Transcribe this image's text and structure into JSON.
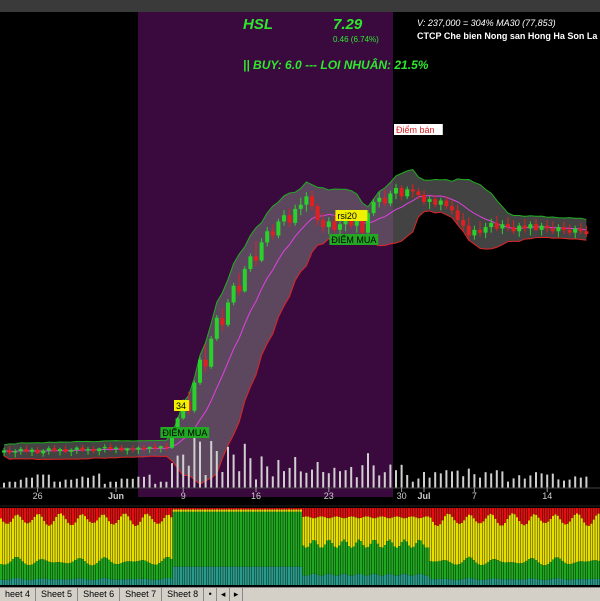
{
  "header": {
    "symbol": "HSL",
    "price": "7.29",
    "change": "0.46 (6.74%)",
    "volume_info": "V: 237,000  =  304%  MA30 (77,853)",
    "company": "CTCP Che bien Nong san Hong Ha Son La",
    "signal": "|| BUY: 6.0  ---  LOI NHUÂN: 21.5%"
  },
  "colors": {
    "background": "#000000",
    "highlight_band": "#3a0a3e",
    "up": "#2bd12b",
    "down": "#e02020",
    "ma": "#e040e0",
    "bb_upper": "#1fae1f",
    "bb_lower": "#e02525",
    "label_green_bg": "#22a822",
    "label_yellow_bg": "#f0f000",
    "label_sell": "#e02020",
    "volume": "#cfcfcf",
    "sentiment_red": "#e01010",
    "sentiment_yellow": "#e8e000",
    "sentiment_green": "#1fa81f",
    "sentiment_teal": "#2a9a8a"
  },
  "chart_data": {
    "type": "candlestick",
    "x_tick_labels": [
      "26",
      "Jun",
      "9",
      "16",
      "23",
      "30",
      "Jul",
      "7",
      "14"
    ],
    "annotations": {
      "buy_label_1": "ĐIỂM MUA",
      "buy_label_2": "ĐIỂM MUA",
      "sell_label": "Điểm bán",
      "tag_34": "34",
      "tag_rsi": "rsi20"
    },
    "price_range": [
      3.3,
      8.6
    ],
    "ohlc": [
      [
        3.55,
        3.62,
        3.5,
        3.58
      ],
      [
        3.58,
        3.64,
        3.52,
        3.55
      ],
      [
        3.55,
        3.6,
        3.48,
        3.57
      ],
      [
        3.57,
        3.63,
        3.52,
        3.6
      ],
      [
        3.6,
        3.65,
        3.55,
        3.56
      ],
      [
        3.56,
        3.62,
        3.5,
        3.59
      ],
      [
        3.59,
        3.63,
        3.53,
        3.54
      ],
      [
        3.54,
        3.6,
        3.49,
        3.58
      ],
      [
        3.58,
        3.64,
        3.52,
        3.61
      ],
      [
        3.61,
        3.66,
        3.55,
        3.57
      ],
      [
        3.57,
        3.62,
        3.51,
        3.6
      ],
      [
        3.6,
        3.65,
        3.54,
        3.56
      ],
      [
        3.56,
        3.61,
        3.5,
        3.59
      ],
      [
        3.59,
        3.64,
        3.53,
        3.62
      ],
      [
        3.62,
        3.66,
        3.56,
        3.58
      ],
      [
        3.58,
        3.63,
        3.52,
        3.6
      ],
      [
        3.6,
        3.64,
        3.54,
        3.57
      ],
      [
        3.57,
        3.62,
        3.51,
        3.61
      ],
      [
        3.61,
        3.67,
        3.55,
        3.63
      ],
      [
        3.63,
        3.68,
        3.57,
        3.6
      ],
      [
        3.6,
        3.64,
        3.54,
        3.62
      ],
      [
        3.62,
        3.66,
        3.56,
        3.58
      ],
      [
        3.58,
        3.62,
        3.52,
        3.61
      ],
      [
        3.61,
        3.65,
        3.55,
        3.59
      ],
      [
        3.59,
        3.64,
        3.53,
        3.62
      ],
      [
        3.62,
        3.66,
        3.56,
        3.6
      ],
      [
        3.6,
        3.64,
        3.54,
        3.63
      ],
      [
        3.63,
        3.68,
        3.57,
        3.61
      ],
      [
        3.61,
        3.65,
        3.55,
        3.64
      ],
      [
        3.64,
        3.69,
        3.58,
        3.62
      ],
      [
        3.62,
        3.82,
        3.6,
        3.8
      ],
      [
        3.8,
        4.06,
        3.78,
        4.04
      ],
      [
        4.04,
        4.31,
        4.02,
        4.28
      ],
      [
        4.28,
        4.42,
        4.1,
        4.15
      ],
      [
        4.15,
        4.58,
        4.12,
        4.55
      ],
      [
        4.55,
        4.92,
        4.52,
        4.88
      ],
      [
        4.88,
        5.1,
        4.7,
        4.78
      ],
      [
        4.78,
        5.22,
        4.75,
        5.18
      ],
      [
        5.18,
        5.52,
        5.15,
        5.48
      ],
      [
        5.48,
        5.62,
        5.3,
        5.38
      ],
      [
        5.38,
        5.75,
        5.35,
        5.7
      ],
      [
        5.7,
        5.98,
        5.66,
        5.94
      ],
      [
        5.94,
        6.12,
        5.8,
        5.86
      ],
      [
        5.86,
        6.22,
        5.84,
        6.18
      ],
      [
        6.18,
        6.4,
        6.14,
        6.36
      ],
      [
        6.36,
        6.58,
        6.22,
        6.3
      ],
      [
        6.3,
        6.62,
        6.28,
        6.56
      ],
      [
        6.56,
        6.78,
        6.5,
        6.72
      ],
      [
        6.72,
        6.82,
        6.6,
        6.66
      ],
      [
        6.66,
        6.9,
        6.62,
        6.86
      ],
      [
        6.86,
        7.02,
        6.8,
        6.95
      ],
      [
        6.95,
        7.05,
        6.78,
        6.84
      ],
      [
        6.84,
        7.1,
        6.8,
        7.04
      ],
      [
        7.04,
        7.2,
        6.95,
        7.1
      ],
      [
        7.1,
        7.28,
        7.0,
        7.22
      ],
      [
        7.22,
        7.3,
        7.02,
        7.08
      ],
      [
        7.08,
        7.12,
        6.8,
        6.88
      ],
      [
        6.88,
        6.98,
        6.7,
        6.78
      ],
      [
        6.78,
        6.92,
        6.68,
        6.86
      ],
      [
        6.86,
        6.95,
        6.7,
        6.74
      ],
      [
        6.74,
        6.9,
        6.62,
        6.82
      ],
      [
        6.82,
        6.96,
        6.72,
        6.9
      ],
      [
        6.9,
        7.0,
        6.76,
        6.8
      ],
      [
        6.8,
        6.94,
        6.7,
        6.88
      ],
      [
        6.88,
        6.98,
        6.62,
        6.7
      ],
      [
        6.7,
        7.02,
        6.68,
        6.98
      ],
      [
        6.98,
        7.18,
        6.94,
        7.14
      ],
      [
        7.14,
        7.28,
        7.06,
        7.2
      ],
      [
        7.2,
        7.32,
        7.08,
        7.12
      ],
      [
        7.12,
        7.3,
        7.08,
        7.26
      ],
      [
        7.26,
        7.4,
        7.18,
        7.34
      ],
      [
        7.34,
        7.38,
        7.16,
        7.22
      ],
      [
        7.22,
        7.36,
        7.18,
        7.32
      ],
      [
        7.32,
        7.4,
        7.2,
        7.29
      ],
      [
        7.29,
        7.34,
        7.18,
        7.24
      ],
      [
        7.24,
        7.3,
        7.1,
        7.14
      ],
      [
        7.14,
        7.22,
        7.04,
        7.18
      ],
      [
        7.18,
        7.24,
        7.06,
        7.1
      ],
      [
        7.1,
        7.2,
        7.02,
        7.16
      ],
      [
        7.16,
        7.22,
        7.04,
        7.08
      ],
      [
        7.08,
        7.16,
        6.96,
        7.02
      ],
      [
        7.02,
        7.1,
        6.82,
        6.88
      ],
      [
        6.88,
        6.98,
        6.72,
        6.8
      ],
      [
        6.8,
        6.92,
        6.58,
        6.66
      ],
      [
        6.66,
        6.8,
        6.6,
        6.74
      ],
      [
        6.74,
        6.86,
        6.64,
        6.7
      ],
      [
        6.7,
        6.84,
        6.62,
        6.78
      ],
      [
        6.78,
        6.9,
        6.7,
        6.84
      ],
      [
        6.84,
        6.94,
        6.72,
        6.76
      ],
      [
        6.76,
        6.88,
        6.68,
        6.82
      ],
      [
        6.82,
        6.92,
        6.72,
        6.78
      ],
      [
        6.78,
        6.88,
        6.68,
        6.72
      ],
      [
        6.72,
        6.84,
        6.64,
        6.8
      ],
      [
        6.8,
        6.9,
        6.7,
        6.76
      ],
      [
        6.76,
        6.86,
        6.66,
        6.82
      ],
      [
        6.82,
        6.9,
        6.72,
        6.74
      ],
      [
        6.74,
        6.84,
        6.66,
        6.8
      ],
      [
        6.8,
        6.88,
        6.7,
        6.76
      ],
      [
        6.76,
        6.86,
        6.68,
        6.72
      ],
      [
        6.72,
        6.82,
        6.64,
        6.78
      ],
      [
        6.78,
        6.86,
        6.68,
        6.74
      ],
      [
        6.74,
        6.82,
        6.66,
        6.7
      ],
      [
        6.7,
        6.8,
        6.62,
        6.76
      ],
      [
        6.76,
        6.84,
        6.68,
        6.72
      ],
      [
        6.72,
        6.8,
        6.64,
        6.68
      ]
    ]
  }
}
